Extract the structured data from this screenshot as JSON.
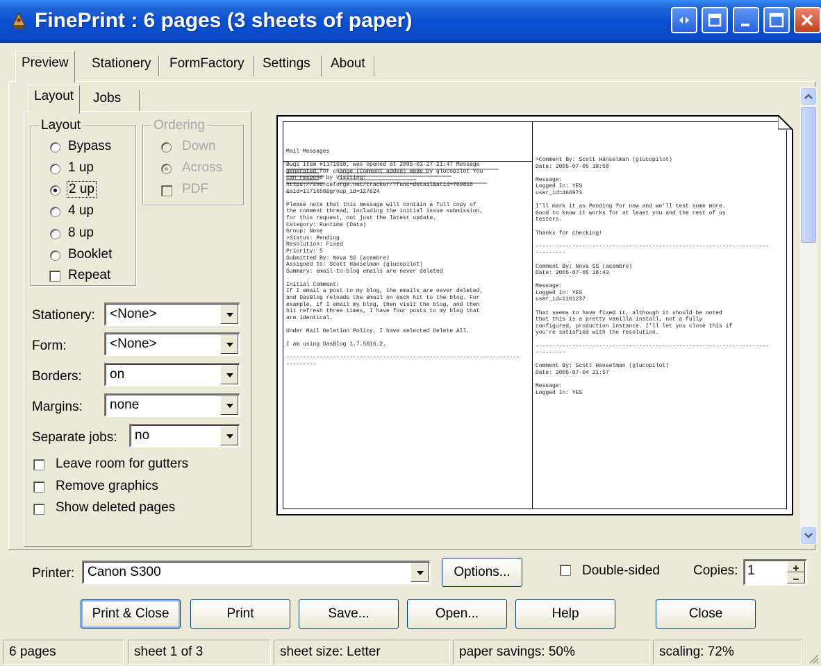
{
  "window": {
    "title": "FinePrint : 6 pages (3 sheets of paper)"
  },
  "tabs": [
    "Preview",
    "Stationery",
    "FormFactory",
    "Settings",
    "About"
  ],
  "subtabs": [
    "Layout",
    "Jobs"
  ],
  "layout_group": {
    "legend": "Layout",
    "options": [
      "Bypass",
      "1 up",
      "2 up",
      "4 up",
      "8 up",
      "Booklet"
    ],
    "selected": "2 up",
    "repeat_label": "Repeat"
  },
  "ordering_group": {
    "legend": "Ordering",
    "options": [
      "Down",
      "Across"
    ],
    "selected": "Across",
    "pdf_label": "PDF"
  },
  "settings": {
    "stationery_label": "Stationery:",
    "stationery_value": "<None>",
    "form_label": "Form:",
    "form_value": "<None>",
    "borders_label": "Borders:",
    "borders_value": "on",
    "margins_label": "Margins:",
    "margins_value": "none",
    "separate_label": "Separate jobs:",
    "separate_value": "no"
  },
  "checkboxes": [
    "Leave room for gutters",
    "Remove graphics",
    "Show deleted pages"
  ],
  "printer": {
    "label": "Printer:",
    "value": "Canon S300",
    "options_button": "Options...",
    "double_sided_label": "Double-sided",
    "copies_label": "Copies:",
    "copies_value": "1"
  },
  "buttons": [
    "Print & Close",
    "Print",
    "Save...",
    "Open...",
    "Help",
    "Close"
  ],
  "status": [
    "6 pages",
    "sheet 1 of 3",
    "sheet size: Letter",
    "paper savings: 50%",
    "scaling: 72%"
  ],
  "preview": {
    "left_page": "Mail Messages\n\nBugs item #1171658, was opened at 2005-03-27 21:47 Message\ngenerated for change (Comment added) made by glucopilot You\ncan respond by visiting:\nhttps://sourceforge.net/tracker/?func=detail&atid=709818\n&aid=1171658&group_id=127624\n\nPlease note that this message will contain a full copy of\nthe comment thread, including the initial issue submission,\nfor this request, not just the latest update.\nCategory: Runtime (Data)\nGroup: None\n>Status: Pending\nResolution: Fixed\nPriority: 5\nSubmitted By: Nova SS (acembre)\nAssigned to: Scott Hanselman (glucopilot)\nSummary: email-to-blog emails are never deleted\n\nInitial Comment:\nIf I email a post to my blog, the emails are never deleted,\nand DasBlog reloads the email on each hit to the blog. For\nexample, if I email my blog, then visit the blog, and then\nhit refresh three times, I have four posts to my blog that\nare identical.\n\nUnder Mail Deletion Policy, I have selected Delete All.\n\nI am using DasBlog 1.7.5016.2.\n\n----------------------------------------------------------------------\n---------",
    "right_page": ">Comment By: Scott Hanselman (glucopilot)\nDate: 2005-07-05 18:58\n\nMessage:\nLogged In: YES\nuser_id=466973\n\nI'll mark it as Pending for now and we'll test some more.\nGood to know it works for at least you and the rest of us\ntesters.\n\nThanks for checking!\n\n----------------------------------------------------------------------\n---------\n\nComment By: Nova SS (acembre)\nDate: 2005-07-05 18:43\n\nMessage:\nLogged In: YES\nuser_id=1161237\n\nThat seems to have fixed it, although it should be noted\nthat this is a pretty vanilla install, not a fully\nconfigured, production instance. I'll let you close this if\nyou're satisfied with the resolution.\n\n----------------------------------------------------------------------\n---------\n\nComment By: Scott Hanselman (glucopilot)\nDate: 2005-07-04 21:57\n\nMessage:\nLogged In: YES"
  },
  "colors": {
    "titlebar": "#0a4fd0",
    "face": "#ece9d8"
  }
}
